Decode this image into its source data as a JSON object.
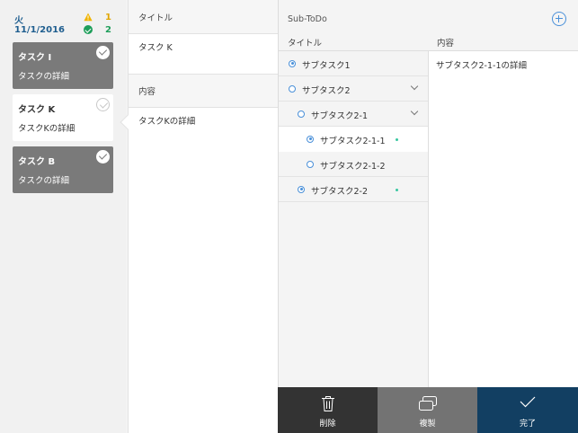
{
  "tasklist": {
    "day_of_week": "火",
    "date": "11/1/2016",
    "warning_count": "1",
    "done_count": "2",
    "cards": [
      {
        "title": "タスク I",
        "detail": "タスクの詳細",
        "state": "done"
      },
      {
        "title": "タスク K",
        "detail": "タスクKの詳細",
        "state": "selected"
      },
      {
        "title": "タスク B",
        "detail": "タスクの詳細",
        "state": "done"
      }
    ]
  },
  "detail": {
    "title_label": "タイトル",
    "title_value": "タスク K",
    "content_label": "内容",
    "content_value": "タスクKの詳細"
  },
  "subtodo": {
    "header": "Sub-ToDo",
    "col_title": "タイトル",
    "col_content": "内容",
    "items": [
      {
        "label": "サブタスク1",
        "level": 0,
        "filled": true,
        "expandable": false,
        "marked": false
      },
      {
        "label": "サブタスク2",
        "level": 0,
        "filled": false,
        "expandable": true,
        "marked": false
      },
      {
        "label": "サブタスク2-1",
        "level": 1,
        "filled": false,
        "expandable": true,
        "marked": false
      },
      {
        "label": "サブタスク2-1-1",
        "level": 2,
        "filled": true,
        "expandable": false,
        "marked": true
      },
      {
        "label": "サブタスク2-1-2",
        "level": 2,
        "filled": false,
        "expandable": false,
        "marked": false
      },
      {
        "label": "サブタスク2-2",
        "level": 1,
        "filled": true,
        "expandable": false,
        "marked": true
      }
    ],
    "selected_index": 3,
    "selected_content": "サブタスク2-1-1の詳細"
  },
  "toolbar": {
    "delete_label": "削除",
    "copy_label": "複製",
    "done_label": "完了"
  },
  "colors": {
    "accent": "#4a90d9",
    "done_button": "#123f62",
    "ok_green": "#1e9e5a",
    "warning_yellow": "#e0a500"
  }
}
